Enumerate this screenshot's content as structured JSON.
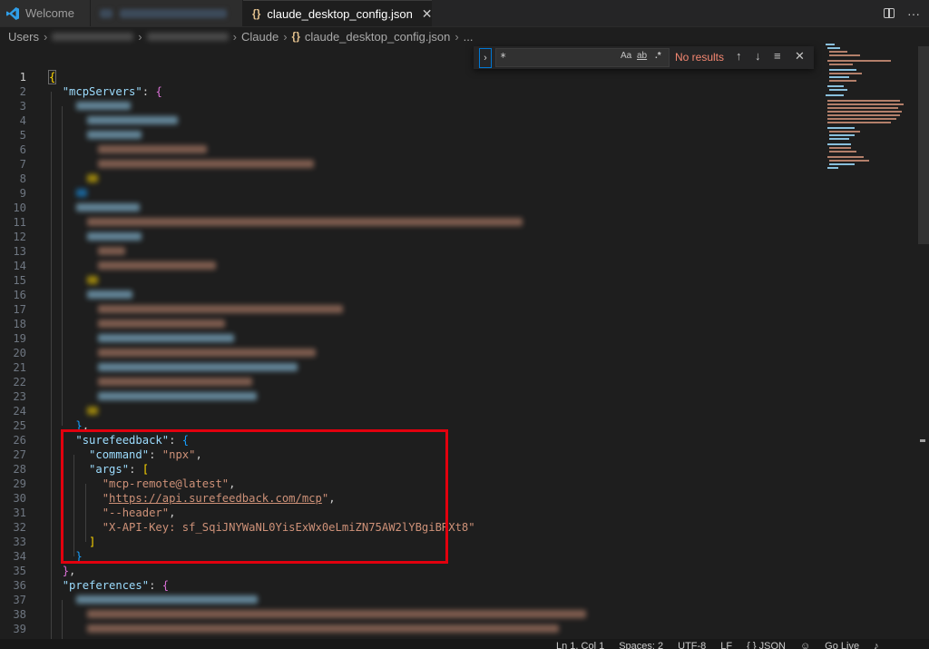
{
  "tabs": {
    "welcome_label": "Welcome",
    "active_label": "claude_desktop_config.json",
    "close_glyph": "✕"
  },
  "breadcrumb": {
    "root": "Users",
    "folder": "Claude",
    "file": "claude_desktop_config.json",
    "trailing": "..."
  },
  "find": {
    "query": "*",
    "match_case": "Aa",
    "whole_word": "ab",
    "regex": ".*",
    "result": "No results"
  },
  "code": {
    "open_brace": "{",
    "mcp_key": "\"mcpServers\"",
    "surefeedback_key": "\"surefeedback\"",
    "command_key": "\"command\"",
    "command_val": "\"npx\"",
    "args_key": "\"args\"",
    "arg1": "\"mcp-remote@latest\"",
    "arg2_q": "\"",
    "arg2_url": "https://api.surefeedback.com/mcp",
    "arg3": "\"--header\"",
    "arg4": "\"X-API-Key: sf_SqiJNYWaNL0YisExWx0eLmiZN75AW2lYBgiBRXt8\"",
    "preferences_key": "\"preferences\""
  },
  "line_numbers": [
    "1",
    "2",
    "3",
    "4",
    "5",
    "6",
    "7",
    "8",
    "9",
    "10",
    "11",
    "12",
    "13",
    "14",
    "15",
    "16",
    "17",
    "18",
    "19",
    "20",
    "21",
    "22",
    "23",
    "24",
    "25",
    "26",
    "27",
    "28",
    "29",
    "30",
    "31",
    "32",
    "33",
    "34",
    "35",
    "36",
    "37",
    "38",
    "39"
  ],
  "status": {
    "position": "Ln 1, Col 1",
    "spaces": "Spaces: 2",
    "encoding": "UTF-8",
    "eol": "LF",
    "language": "{ } JSON",
    "golive": "Go Live"
  },
  "colors": {
    "key": "#9cdcfe",
    "string": "#ce9178",
    "bracket_level1": "#ffd700",
    "bracket_level2": "#da70d6",
    "bracket_level3": "#179fff",
    "highlight_box": "#e2000e",
    "no_results": "#f48771"
  }
}
